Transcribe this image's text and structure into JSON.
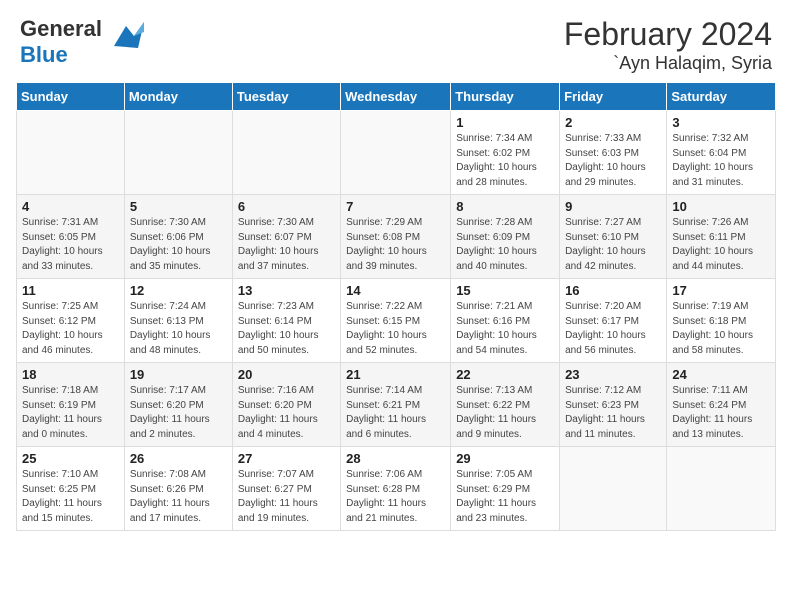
{
  "header": {
    "logo_line1": "General",
    "logo_line2": "Blue",
    "month_year": "February 2024",
    "location": "`Ayn Halaqim, Syria"
  },
  "days_of_week": [
    "Sunday",
    "Monday",
    "Tuesday",
    "Wednesday",
    "Thursday",
    "Friday",
    "Saturday"
  ],
  "weeks": [
    [
      {
        "day": "",
        "sunrise": "",
        "sunset": "",
        "daylight": "",
        "empty": true
      },
      {
        "day": "",
        "sunrise": "",
        "sunset": "",
        "daylight": "",
        "empty": true
      },
      {
        "day": "",
        "sunrise": "",
        "sunset": "",
        "daylight": "",
        "empty": true
      },
      {
        "day": "",
        "sunrise": "",
        "sunset": "",
        "daylight": "",
        "empty": true
      },
      {
        "day": "1",
        "sunrise": "Sunrise: 7:34 AM",
        "sunset": "Sunset: 6:02 PM",
        "daylight": "Daylight: 10 hours and 28 minutes."
      },
      {
        "day": "2",
        "sunrise": "Sunrise: 7:33 AM",
        "sunset": "Sunset: 6:03 PM",
        "daylight": "Daylight: 10 hours and 29 minutes."
      },
      {
        "day": "3",
        "sunrise": "Sunrise: 7:32 AM",
        "sunset": "Sunset: 6:04 PM",
        "daylight": "Daylight: 10 hours and 31 minutes."
      }
    ],
    [
      {
        "day": "4",
        "sunrise": "Sunrise: 7:31 AM",
        "sunset": "Sunset: 6:05 PM",
        "daylight": "Daylight: 10 hours and 33 minutes."
      },
      {
        "day": "5",
        "sunrise": "Sunrise: 7:30 AM",
        "sunset": "Sunset: 6:06 PM",
        "daylight": "Daylight: 10 hours and 35 minutes."
      },
      {
        "day": "6",
        "sunrise": "Sunrise: 7:30 AM",
        "sunset": "Sunset: 6:07 PM",
        "daylight": "Daylight: 10 hours and 37 minutes."
      },
      {
        "day": "7",
        "sunrise": "Sunrise: 7:29 AM",
        "sunset": "Sunset: 6:08 PM",
        "daylight": "Daylight: 10 hours and 39 minutes."
      },
      {
        "day": "8",
        "sunrise": "Sunrise: 7:28 AM",
        "sunset": "Sunset: 6:09 PM",
        "daylight": "Daylight: 10 hours and 40 minutes."
      },
      {
        "day": "9",
        "sunrise": "Sunrise: 7:27 AM",
        "sunset": "Sunset: 6:10 PM",
        "daylight": "Daylight: 10 hours and 42 minutes."
      },
      {
        "day": "10",
        "sunrise": "Sunrise: 7:26 AM",
        "sunset": "Sunset: 6:11 PM",
        "daylight": "Daylight: 10 hours and 44 minutes."
      }
    ],
    [
      {
        "day": "11",
        "sunrise": "Sunrise: 7:25 AM",
        "sunset": "Sunset: 6:12 PM",
        "daylight": "Daylight: 10 hours and 46 minutes."
      },
      {
        "day": "12",
        "sunrise": "Sunrise: 7:24 AM",
        "sunset": "Sunset: 6:13 PM",
        "daylight": "Daylight: 10 hours and 48 minutes."
      },
      {
        "day": "13",
        "sunrise": "Sunrise: 7:23 AM",
        "sunset": "Sunset: 6:14 PM",
        "daylight": "Daylight: 10 hours and 50 minutes."
      },
      {
        "day": "14",
        "sunrise": "Sunrise: 7:22 AM",
        "sunset": "Sunset: 6:15 PM",
        "daylight": "Daylight: 10 hours and 52 minutes."
      },
      {
        "day": "15",
        "sunrise": "Sunrise: 7:21 AM",
        "sunset": "Sunset: 6:16 PM",
        "daylight": "Daylight: 10 hours and 54 minutes."
      },
      {
        "day": "16",
        "sunrise": "Sunrise: 7:20 AM",
        "sunset": "Sunset: 6:17 PM",
        "daylight": "Daylight: 10 hours and 56 minutes."
      },
      {
        "day": "17",
        "sunrise": "Sunrise: 7:19 AM",
        "sunset": "Sunset: 6:18 PM",
        "daylight": "Daylight: 10 hours and 58 minutes."
      }
    ],
    [
      {
        "day": "18",
        "sunrise": "Sunrise: 7:18 AM",
        "sunset": "Sunset: 6:19 PM",
        "daylight": "Daylight: 11 hours and 0 minutes."
      },
      {
        "day": "19",
        "sunrise": "Sunrise: 7:17 AM",
        "sunset": "Sunset: 6:20 PM",
        "daylight": "Daylight: 11 hours and 2 minutes."
      },
      {
        "day": "20",
        "sunrise": "Sunrise: 7:16 AM",
        "sunset": "Sunset: 6:20 PM",
        "daylight": "Daylight: 11 hours and 4 minutes."
      },
      {
        "day": "21",
        "sunrise": "Sunrise: 7:14 AM",
        "sunset": "Sunset: 6:21 PM",
        "daylight": "Daylight: 11 hours and 6 minutes."
      },
      {
        "day": "22",
        "sunrise": "Sunrise: 7:13 AM",
        "sunset": "Sunset: 6:22 PM",
        "daylight": "Daylight: 11 hours and 9 minutes."
      },
      {
        "day": "23",
        "sunrise": "Sunrise: 7:12 AM",
        "sunset": "Sunset: 6:23 PM",
        "daylight": "Daylight: 11 hours and 11 minutes."
      },
      {
        "day": "24",
        "sunrise": "Sunrise: 7:11 AM",
        "sunset": "Sunset: 6:24 PM",
        "daylight": "Daylight: 11 hours and 13 minutes."
      }
    ],
    [
      {
        "day": "25",
        "sunrise": "Sunrise: 7:10 AM",
        "sunset": "Sunset: 6:25 PM",
        "daylight": "Daylight: 11 hours and 15 minutes."
      },
      {
        "day": "26",
        "sunrise": "Sunrise: 7:08 AM",
        "sunset": "Sunset: 6:26 PM",
        "daylight": "Daylight: 11 hours and 17 minutes."
      },
      {
        "day": "27",
        "sunrise": "Sunrise: 7:07 AM",
        "sunset": "Sunset: 6:27 PM",
        "daylight": "Daylight: 11 hours and 19 minutes."
      },
      {
        "day": "28",
        "sunrise": "Sunrise: 7:06 AM",
        "sunset": "Sunset: 6:28 PM",
        "daylight": "Daylight: 11 hours and 21 minutes."
      },
      {
        "day": "29",
        "sunrise": "Sunrise: 7:05 AM",
        "sunset": "Sunset: 6:29 PM",
        "daylight": "Daylight: 11 hours and 23 minutes."
      },
      {
        "day": "",
        "sunrise": "",
        "sunset": "",
        "daylight": "",
        "empty": true
      },
      {
        "day": "",
        "sunrise": "",
        "sunset": "",
        "daylight": "",
        "empty": true
      }
    ]
  ],
  "colors": {
    "header_bg": "#1a75bb",
    "header_text": "#ffffff",
    "accent": "#1a75bb"
  }
}
